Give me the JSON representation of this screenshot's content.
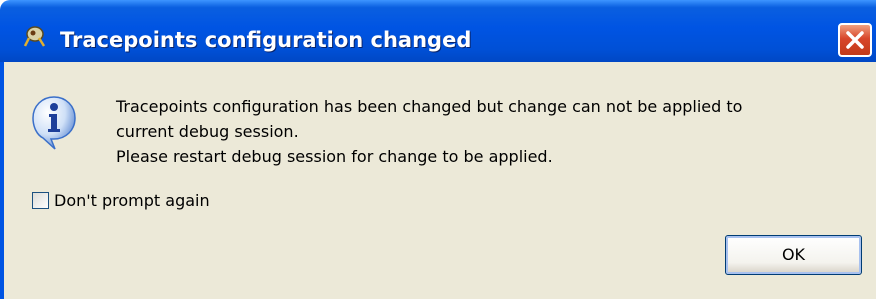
{
  "title": "Tracepoints configuration changed",
  "message_lines": [
    "Tracepoints configuration has been changed but change can not be applied to",
    "current debug session.",
    "Please restart debug session for change to be applied."
  ],
  "checkbox": {
    "label": "Don't prompt again",
    "checked": false
  },
  "ok_button": "OK",
  "icons": {
    "app": "eclipse-app-icon",
    "info": "info-icon",
    "close": "close-icon"
  },
  "colors": {
    "titlebar": "#0054e3",
    "client": "#ece9d8",
    "close": "#d8462a"
  }
}
